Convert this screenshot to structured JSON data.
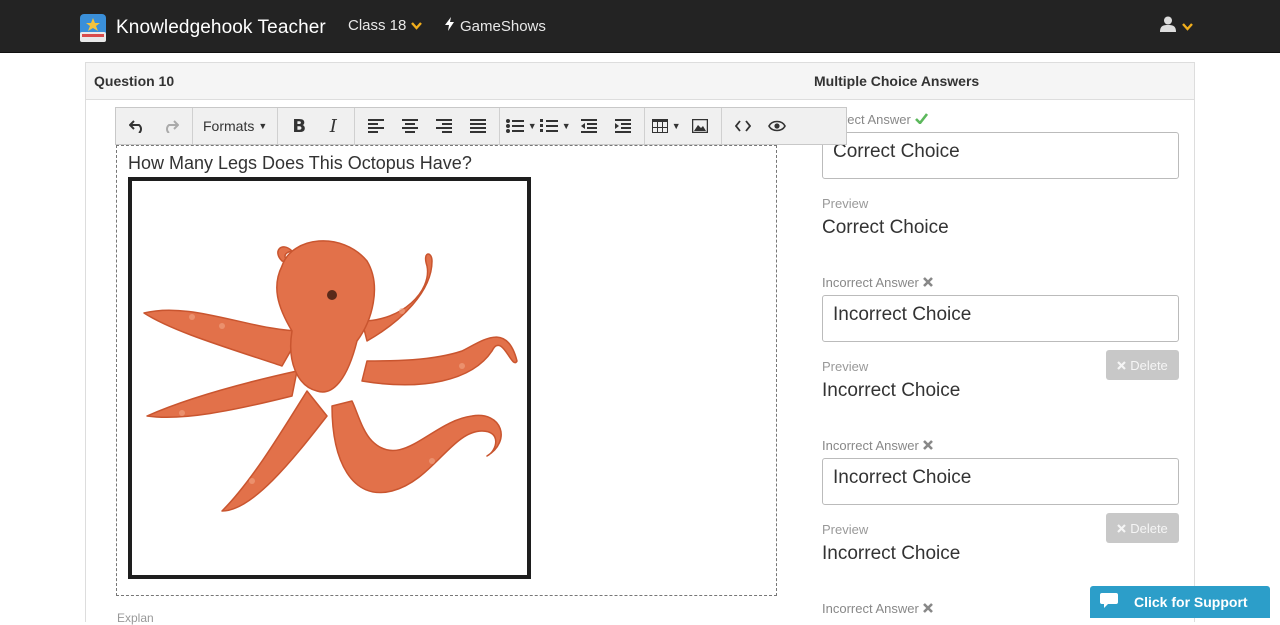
{
  "navbar": {
    "brand": "Knowledgehook Teacher",
    "class_menu": "Class 18",
    "gameshows": "GameShows",
    "accent_color": "#f0ad1c"
  },
  "editor": {
    "header": "Question 10",
    "toolbar": {
      "formats_label": "Formats",
      "icons": [
        "undo-icon",
        "redo-icon",
        "bold-icon",
        "italic-icon",
        "align-left-icon",
        "align-center-icon",
        "align-right-icon",
        "align-justify-icon",
        "bullet-list-icon",
        "numbered-list-icon",
        "outdent-icon",
        "indent-icon",
        "table-icon",
        "image-icon",
        "code-icon",
        "preview-eye-icon"
      ]
    },
    "question_text": "How Many Legs Does This Octopus Have?",
    "below_label": "Explan"
  },
  "answers": {
    "header": "Multiple Choice Answers",
    "preview_label": "Preview",
    "delete_label": "Delete",
    "items": [
      {
        "label": "Correct Answer",
        "value": "Correct Choice",
        "preview": "Correct Choice",
        "correct": true
      },
      {
        "label": "Incorrect Answer",
        "value": "Incorrect Choice",
        "preview": "Incorrect Choice",
        "correct": false
      },
      {
        "label": "Incorrect Answer",
        "value": "Incorrect Choice",
        "preview": "Incorrect Choice",
        "correct": false
      },
      {
        "label": "Incorrect Answer",
        "value": "",
        "preview": "",
        "correct": false
      }
    ]
  },
  "support": {
    "label": "Click for Support",
    "color": "#2c9ec9"
  }
}
